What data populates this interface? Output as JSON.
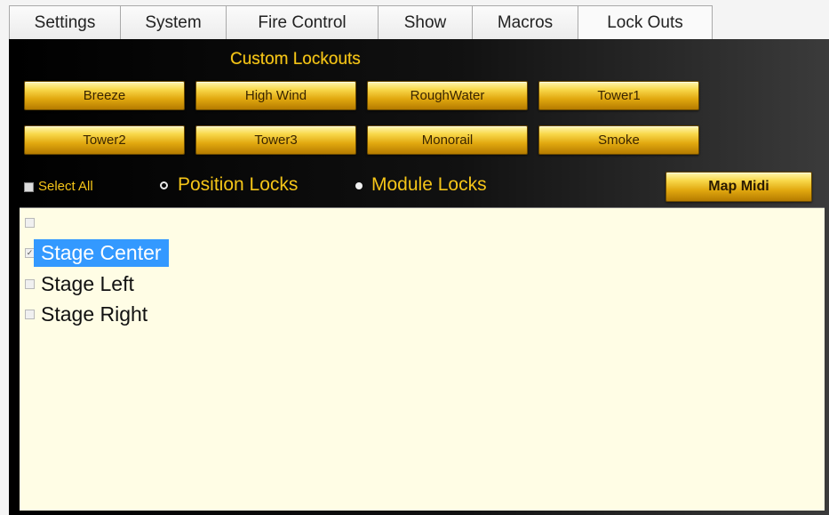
{
  "tabs": [
    {
      "label": "Settings"
    },
    {
      "label": "System"
    },
    {
      "label": "Fire Control"
    },
    {
      "label": "Show"
    },
    {
      "label": "Macros"
    },
    {
      "label": "Lock Outs",
      "active": true
    }
  ],
  "custom_lockouts": {
    "title": "Custom Lockouts",
    "buttons": [
      "Breeze",
      "High Wind",
      "RoughWater",
      "Tower1",
      "Tower2",
      "Tower3",
      "Monorail",
      "Smoke"
    ]
  },
  "options": {
    "select_all_label": "Select All",
    "select_all_checked": false,
    "position_locks_label": "Position Locks",
    "module_locks_label": "Module Locks",
    "selected_mode": "Module Locks",
    "map_midi_label": "Map Midi"
  },
  "list": {
    "items": [
      {
        "label": "",
        "checked": false,
        "selected": false
      },
      {
        "label": "Stage Center",
        "checked": true,
        "selected": true
      },
      {
        "label": "Stage Left",
        "checked": false,
        "selected": false
      },
      {
        "label": "Stage Right",
        "checked": false,
        "selected": false
      }
    ]
  },
  "colors": {
    "accent_gold": "#f5c518",
    "list_background": "#fffde5",
    "selection": "#3399ff"
  }
}
